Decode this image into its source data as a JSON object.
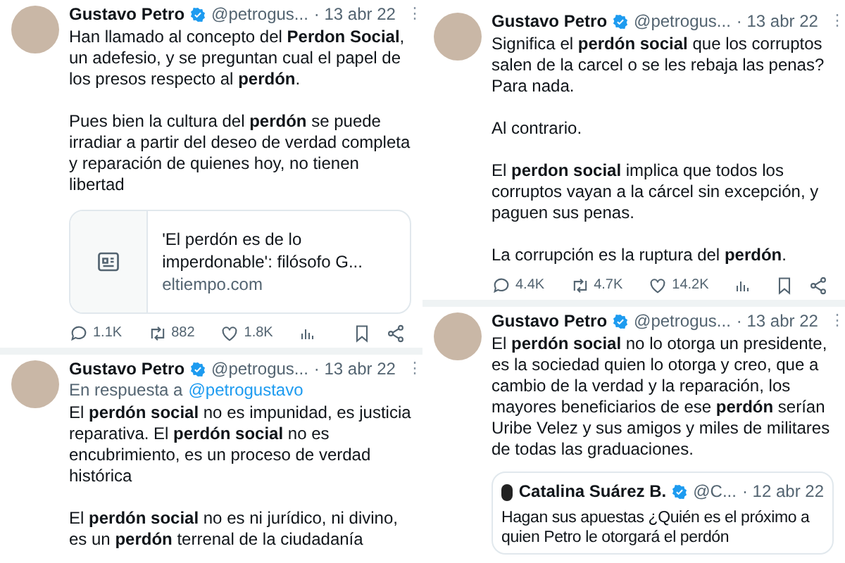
{
  "columns": [
    {
      "tweets": [
        {
          "author": "Gustavo Petro",
          "verified": true,
          "handle": "@petrogus...",
          "date": "· 13 abr 22",
          "more": "⋮",
          "paragraphs": [
            "Han llamado al concepto del **Perdon Social**, un adefesio, y se preguntan cual el papel de los presos respecto al **perdón**.",
            "Pues bien la cultura del **perdón** se puede irradiar a partir del deseo de verdad completa y reparación de quienes hoy, no tienen libertad"
          ],
          "link_card": {
            "title": "'El perdón es de lo imperdonable': filósofo G...",
            "domain": "eltiempo.com"
          },
          "stats": {
            "replies": "1.1K",
            "retweets": "882",
            "likes": "1.8K"
          }
        },
        {
          "author": "Gustavo Petro",
          "verified": true,
          "handle": "@petrogus...",
          "date": "· 13 abr 22",
          "more": "⋮",
          "reply_label": "En respuesta a",
          "reply_to": "@petrogustavo",
          "paragraphs": [
            "El **perdón social** no es impunidad, es justicia reparativa. El **perdón social** no es encubrimiento, es un proceso de verdad histórica",
            "El **perdón social** no es ni jurídico, ni divino, es un **perdón** terrenal de la ciudadanía"
          ]
        }
      ]
    },
    {
      "tweets": [
        {
          "author": "Gustavo Petro",
          "verified": true,
          "handle": "@petrogus...",
          "date": "· 13 abr 22",
          "more": "⋮",
          "paragraphs": [
            "Significa el **perdón social** que los corruptos salen de la carcel o se les rebaja las penas? Para nada.",
            "Al contrario.",
            "El **perdon social** implica que todos los corruptos vayan a la cárcel sin excepción, y paguen sus penas.",
            "La corrupción es la ruptura del **perdón**."
          ],
          "stats": {
            "replies": "4.4K",
            "retweets": "4.7K",
            "likes": "14.2K"
          }
        },
        {
          "author": "Gustavo Petro",
          "verified": true,
          "handle": "@petrogus...",
          "date": "· 13 abr 22",
          "more": "⋮",
          "paragraphs": [
            "El **perdón social** no lo otorga un presidente, es la sociedad quien lo otorga y creo, que a cambio de la verdad y la reparación, los mayores beneficiarios de ese **perdón** serían Uribe Velez y sus amigos y miles de militares de todas las graduaciones."
          ],
          "quote": {
            "author": "Catalina Suárez B.",
            "verified": true,
            "handle": "@C...",
            "date": "· 12 abr 22",
            "text": "Hagan sus apuestas ¿Quién es el próximo a quien Petro le otorgará el perdón"
          }
        }
      ]
    }
  ]
}
